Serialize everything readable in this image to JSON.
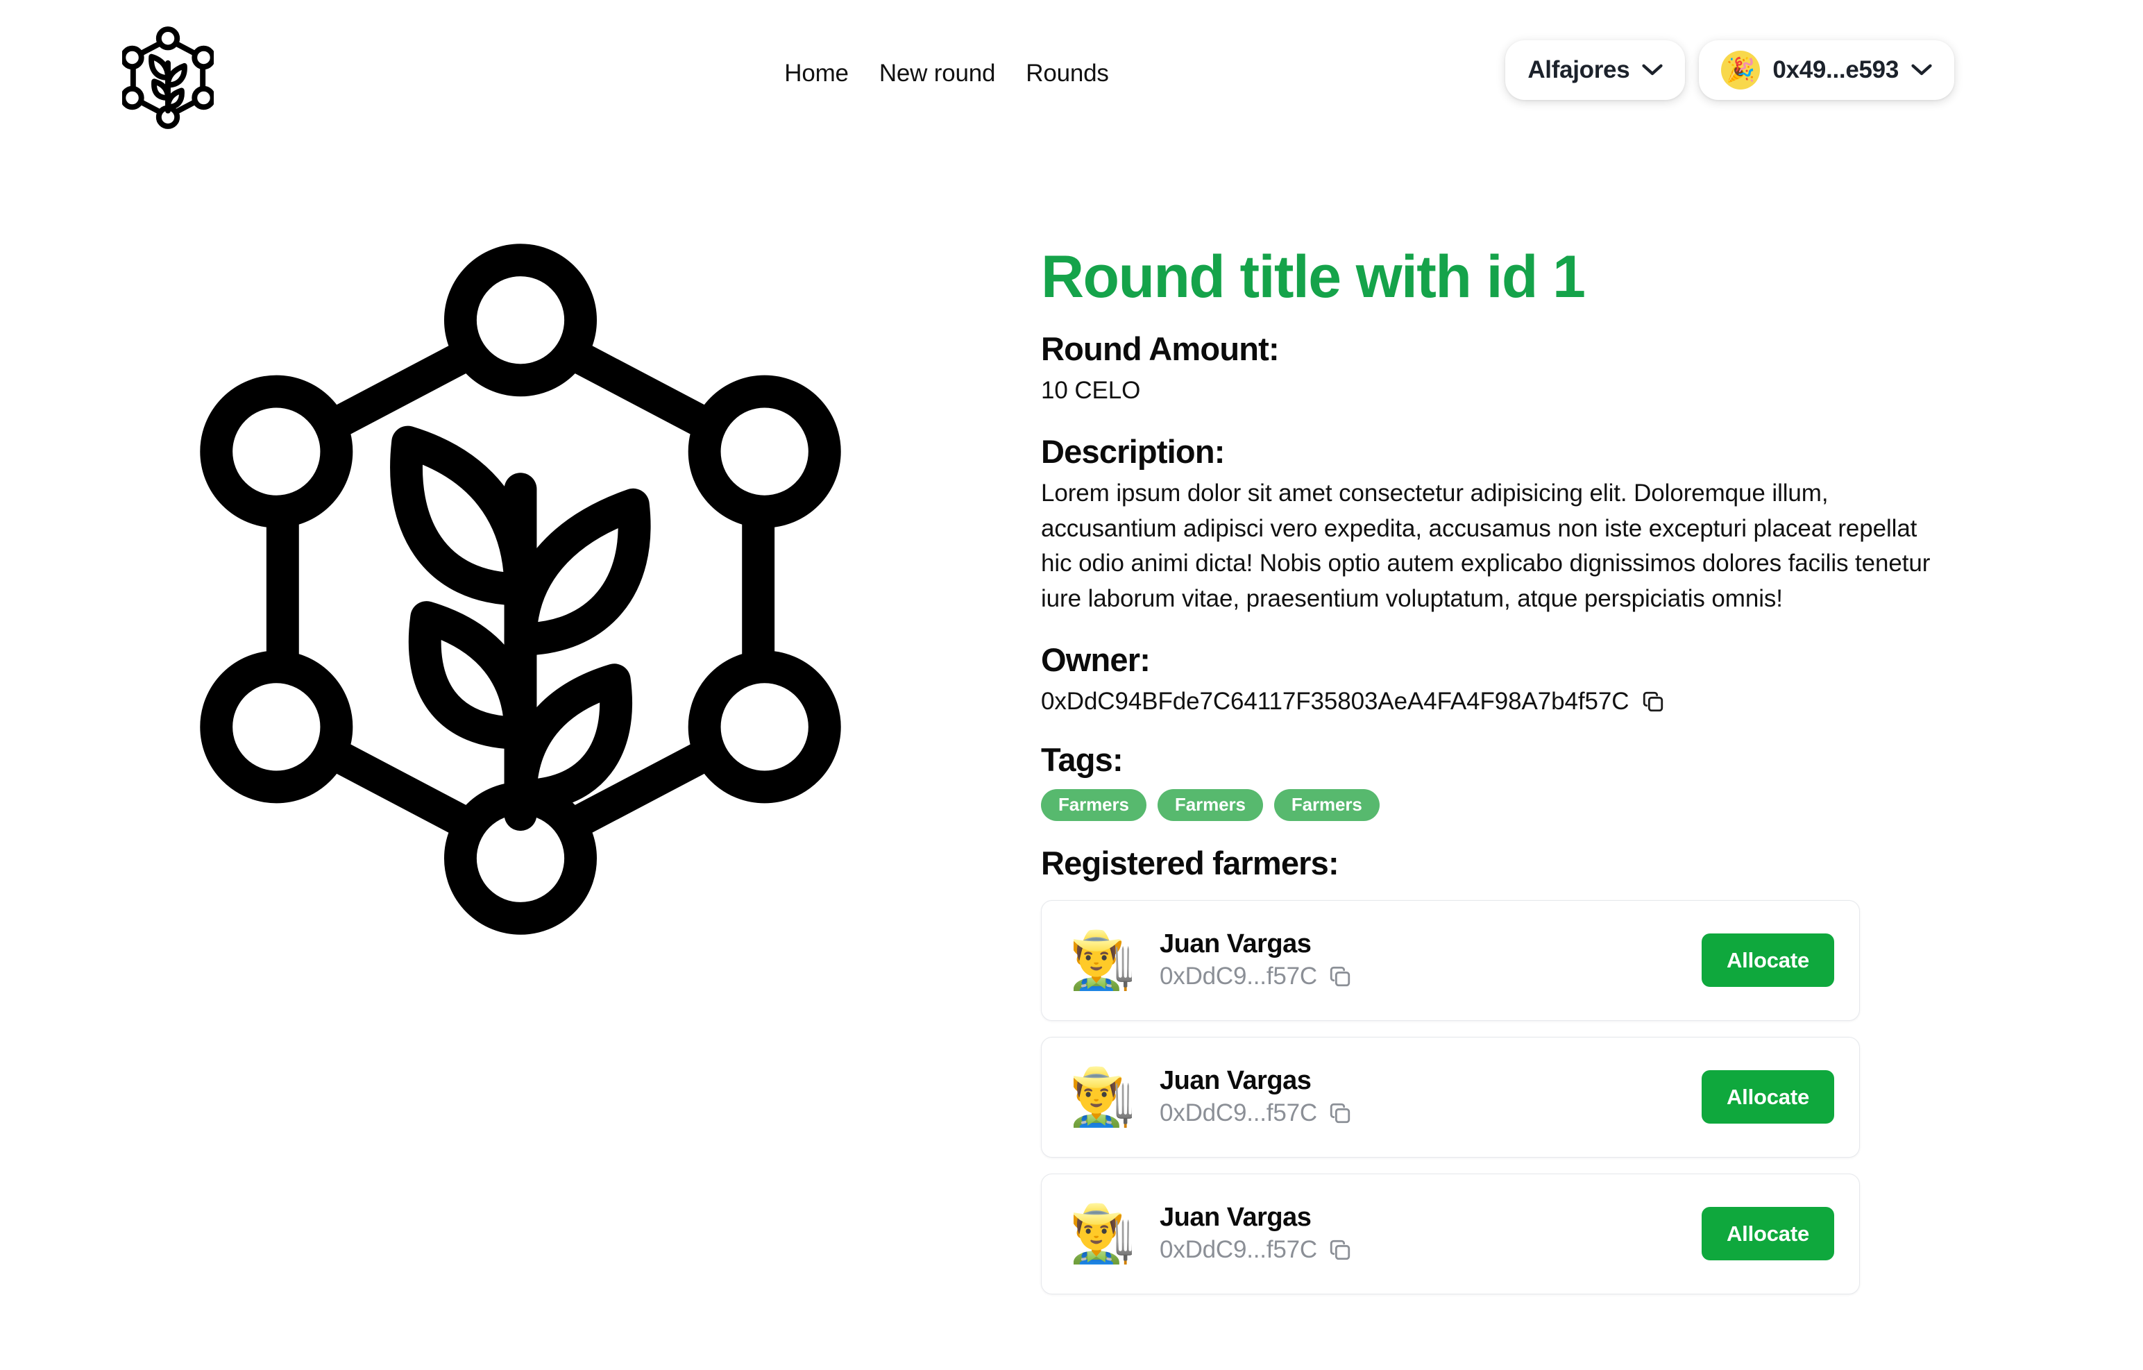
{
  "header": {
    "logo_icon": "hexagon-network-plant-logo",
    "nav": [
      {
        "label": "Home",
        "name": "nav-link-home"
      },
      {
        "label": "New round",
        "name": "nav-link-new-round"
      },
      {
        "label": "Rounds",
        "name": "nav-link-rounds"
      }
    ],
    "network_selector": {
      "label": "Alfajores",
      "chevron_icon": "chevron-down-icon"
    },
    "wallet": {
      "avatar_emoji": "🎉",
      "avatar_bg": "#f8d84b",
      "label": "0x49...e593",
      "chevron_icon": "chevron-down-icon"
    }
  },
  "hero": {
    "logo_icon": "hexagon-network-plant-logo"
  },
  "round": {
    "title": "Round title with id 1",
    "title_color": "#15a34a",
    "amount_heading": "Round Amount:",
    "amount_value": "10 CELO",
    "description_heading": "Description:",
    "description_text": "Lorem ipsum dolor sit amet consectetur adipisicing elit. Doloremque illum, accusantium adipisci vero expedita, accusamus non iste excepturi placeat repellat hic odio animi dicta! Nobis optio autem explicabo dignissimos dolores facilis tenetur iure laborum vitae, praesentium voluptatum, atque perspiciatis omnis!",
    "owner_heading": "Owner:",
    "owner_address": "0xDdC94BFde7C64117F35803AeA4FA4F98A7b4f57C",
    "owner_copy_icon": "copy-icon",
    "tags_heading": "Tags:",
    "tags": [
      "Farmers",
      "Farmers",
      "Farmers"
    ],
    "tag_color": "#57b96e",
    "farmers_heading": "Registered farmers:",
    "allocate_color": "#0fa83d",
    "farmers": [
      {
        "avatar_emoji": "👨‍🌾",
        "name": "Juan Vargas",
        "address": "0xDdC9...f57C",
        "copy_icon": "copy-icon",
        "action_label": "Allocate"
      },
      {
        "avatar_emoji": "👨‍🌾",
        "name": "Juan Vargas",
        "address": "0xDdC9...f57C",
        "copy_icon": "copy-icon",
        "action_label": "Allocate"
      },
      {
        "avatar_emoji": "👨‍🌾",
        "name": "Juan Vargas",
        "address": "0xDdC9...f57C",
        "copy_icon": "copy-icon",
        "action_label": "Allocate"
      }
    ]
  }
}
